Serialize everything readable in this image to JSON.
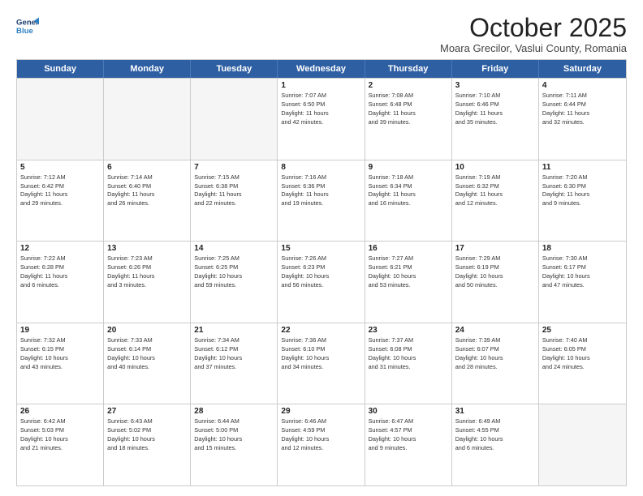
{
  "header": {
    "logo_line1": "General",
    "logo_line2": "Blue",
    "month_title": "October 2025",
    "subtitle": "Moara Grecilor, Vaslui County, Romania"
  },
  "days_of_week": [
    "Sunday",
    "Monday",
    "Tuesday",
    "Wednesday",
    "Thursday",
    "Friday",
    "Saturday"
  ],
  "rows": [
    [
      {
        "day": "",
        "lines": []
      },
      {
        "day": "",
        "lines": []
      },
      {
        "day": "",
        "lines": []
      },
      {
        "day": "1",
        "lines": [
          "Sunrise: 7:07 AM",
          "Sunset: 6:50 PM",
          "Daylight: 11 hours",
          "and 42 minutes."
        ]
      },
      {
        "day": "2",
        "lines": [
          "Sunrise: 7:08 AM",
          "Sunset: 6:48 PM",
          "Daylight: 11 hours",
          "and 39 minutes."
        ]
      },
      {
        "day": "3",
        "lines": [
          "Sunrise: 7:10 AM",
          "Sunset: 6:46 PM",
          "Daylight: 11 hours",
          "and 35 minutes."
        ]
      },
      {
        "day": "4",
        "lines": [
          "Sunrise: 7:11 AM",
          "Sunset: 6:44 PM",
          "Daylight: 11 hours",
          "and 32 minutes."
        ]
      }
    ],
    [
      {
        "day": "5",
        "lines": [
          "Sunrise: 7:12 AM",
          "Sunset: 6:42 PM",
          "Daylight: 11 hours",
          "and 29 minutes."
        ]
      },
      {
        "day": "6",
        "lines": [
          "Sunrise: 7:14 AM",
          "Sunset: 6:40 PM",
          "Daylight: 11 hours",
          "and 26 minutes."
        ]
      },
      {
        "day": "7",
        "lines": [
          "Sunrise: 7:15 AM",
          "Sunset: 6:38 PM",
          "Daylight: 11 hours",
          "and 22 minutes."
        ]
      },
      {
        "day": "8",
        "lines": [
          "Sunrise: 7:16 AM",
          "Sunset: 6:36 PM",
          "Daylight: 11 hours",
          "and 19 minutes."
        ]
      },
      {
        "day": "9",
        "lines": [
          "Sunrise: 7:18 AM",
          "Sunset: 6:34 PM",
          "Daylight: 11 hours",
          "and 16 minutes."
        ]
      },
      {
        "day": "10",
        "lines": [
          "Sunrise: 7:19 AM",
          "Sunset: 6:32 PM",
          "Daylight: 11 hours",
          "and 12 minutes."
        ]
      },
      {
        "day": "11",
        "lines": [
          "Sunrise: 7:20 AM",
          "Sunset: 6:30 PM",
          "Daylight: 11 hours",
          "and 9 minutes."
        ]
      }
    ],
    [
      {
        "day": "12",
        "lines": [
          "Sunrise: 7:22 AM",
          "Sunset: 6:28 PM",
          "Daylight: 11 hours",
          "and 6 minutes."
        ]
      },
      {
        "day": "13",
        "lines": [
          "Sunrise: 7:23 AM",
          "Sunset: 6:26 PM",
          "Daylight: 11 hours",
          "and 3 minutes."
        ]
      },
      {
        "day": "14",
        "lines": [
          "Sunrise: 7:25 AM",
          "Sunset: 6:25 PM",
          "Daylight: 10 hours",
          "and 59 minutes."
        ]
      },
      {
        "day": "15",
        "lines": [
          "Sunrise: 7:26 AM",
          "Sunset: 6:23 PM",
          "Daylight: 10 hours",
          "and 56 minutes."
        ]
      },
      {
        "day": "16",
        "lines": [
          "Sunrise: 7:27 AM",
          "Sunset: 6:21 PM",
          "Daylight: 10 hours",
          "and 53 minutes."
        ]
      },
      {
        "day": "17",
        "lines": [
          "Sunrise: 7:29 AM",
          "Sunset: 6:19 PM",
          "Daylight: 10 hours",
          "and 50 minutes."
        ]
      },
      {
        "day": "18",
        "lines": [
          "Sunrise: 7:30 AM",
          "Sunset: 6:17 PM",
          "Daylight: 10 hours",
          "and 47 minutes."
        ]
      }
    ],
    [
      {
        "day": "19",
        "lines": [
          "Sunrise: 7:32 AM",
          "Sunset: 6:15 PM",
          "Daylight: 10 hours",
          "and 43 minutes."
        ]
      },
      {
        "day": "20",
        "lines": [
          "Sunrise: 7:33 AM",
          "Sunset: 6:14 PM",
          "Daylight: 10 hours",
          "and 40 minutes."
        ]
      },
      {
        "day": "21",
        "lines": [
          "Sunrise: 7:34 AM",
          "Sunset: 6:12 PM",
          "Daylight: 10 hours",
          "and 37 minutes."
        ]
      },
      {
        "day": "22",
        "lines": [
          "Sunrise: 7:36 AM",
          "Sunset: 6:10 PM",
          "Daylight: 10 hours",
          "and 34 minutes."
        ]
      },
      {
        "day": "23",
        "lines": [
          "Sunrise: 7:37 AM",
          "Sunset: 6:08 PM",
          "Daylight: 10 hours",
          "and 31 minutes."
        ]
      },
      {
        "day": "24",
        "lines": [
          "Sunrise: 7:39 AM",
          "Sunset: 6:07 PM",
          "Daylight: 10 hours",
          "and 28 minutes."
        ]
      },
      {
        "day": "25",
        "lines": [
          "Sunrise: 7:40 AM",
          "Sunset: 6:05 PM",
          "Daylight: 10 hours",
          "and 24 minutes."
        ]
      }
    ],
    [
      {
        "day": "26",
        "lines": [
          "Sunrise: 6:42 AM",
          "Sunset: 5:03 PM",
          "Daylight: 10 hours",
          "and 21 minutes."
        ]
      },
      {
        "day": "27",
        "lines": [
          "Sunrise: 6:43 AM",
          "Sunset: 5:02 PM",
          "Daylight: 10 hours",
          "and 18 minutes."
        ]
      },
      {
        "day": "28",
        "lines": [
          "Sunrise: 6:44 AM",
          "Sunset: 5:00 PM",
          "Daylight: 10 hours",
          "and 15 minutes."
        ]
      },
      {
        "day": "29",
        "lines": [
          "Sunrise: 6:46 AM",
          "Sunset: 4:59 PM",
          "Daylight: 10 hours",
          "and 12 minutes."
        ]
      },
      {
        "day": "30",
        "lines": [
          "Sunrise: 6:47 AM",
          "Sunset: 4:57 PM",
          "Daylight: 10 hours",
          "and 9 minutes."
        ]
      },
      {
        "day": "31",
        "lines": [
          "Sunrise: 6:49 AM",
          "Sunset: 4:55 PM",
          "Daylight: 10 hours",
          "and 6 minutes."
        ]
      },
      {
        "day": "",
        "lines": []
      }
    ]
  ]
}
